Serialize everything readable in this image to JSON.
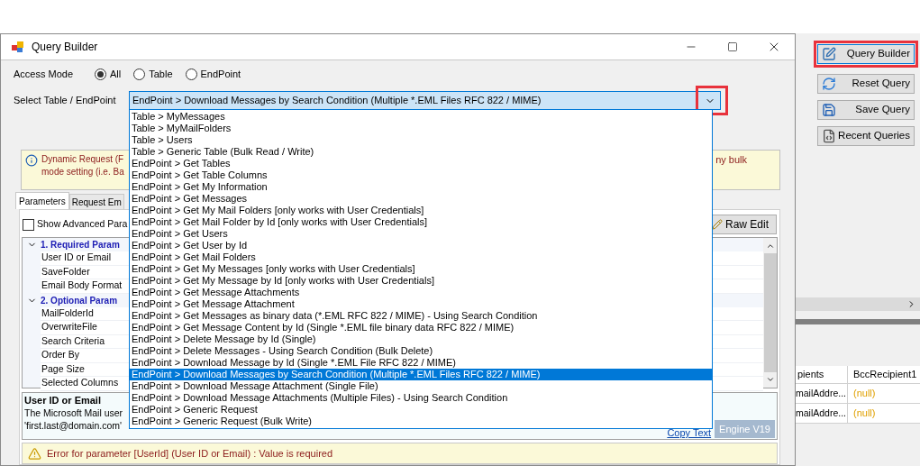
{
  "window": {
    "title": "Query Builder"
  },
  "access_mode": {
    "label": "Access Mode",
    "options": [
      {
        "label": "All",
        "selected": true
      },
      {
        "label": "Table",
        "selected": false
      },
      {
        "label": "EndPoint",
        "selected": false
      }
    ]
  },
  "select": {
    "label": "Select Table / EndPoint",
    "value": "EndPoint > Download Messages by Search Condition (Multiple *.EML Files RFC 822 / MIME)",
    "arrow_highlighted": true,
    "options": [
      {
        "label": "Table > MyMessages",
        "selected": false
      },
      {
        "label": "Table > MyMailFolders",
        "selected": false
      },
      {
        "label": "Table > Users",
        "selected": false
      },
      {
        "label": "Table > Generic Table (Bulk Read / Write)",
        "selected": false
      },
      {
        "label": "EndPoint > Get Tables",
        "selected": false
      },
      {
        "label": "EndPoint > Get Table Columns",
        "selected": false
      },
      {
        "label": "EndPoint > Get My Information",
        "selected": false
      },
      {
        "label": "EndPoint > Get Messages",
        "selected": false
      },
      {
        "label": "EndPoint > Get My Mail Folders [only works with User Credentials]",
        "selected": false
      },
      {
        "label": "EndPoint > Get Mail Folder by Id [only works with User Credentials]",
        "selected": false
      },
      {
        "label": "EndPoint > Get Users",
        "selected": false
      },
      {
        "label": "EndPoint > Get User by Id",
        "selected": false
      },
      {
        "label": "EndPoint > Get Mail Folders",
        "selected": false
      },
      {
        "label": "EndPoint > Get My Messages [only works with User Credentials]",
        "selected": false
      },
      {
        "label": "EndPoint > Get My Message by Id [only works with User Credentials]",
        "selected": false
      },
      {
        "label": "EndPoint > Get Message Attachments",
        "selected": false
      },
      {
        "label": "EndPoint > Get Message Attachment",
        "selected": false
      },
      {
        "label": "EndPoint > Get Messages as binary data (*.EML RFC 822 / MIME) - Using Search Condition",
        "selected": false
      },
      {
        "label": "EndPoint > Get Message Content by Id (Single *.EML file binary data RFC 822 / MIME)",
        "selected": false
      },
      {
        "label": "EndPoint > Delete Message by Id (Single)",
        "selected": false
      },
      {
        "label": "EndPoint > Delete Messages - Using Search Condition (Bulk Delete)",
        "selected": false
      },
      {
        "label": "EndPoint > Download Message by Id (Single *.EML File RFC 822 / MIME)",
        "selected": false
      },
      {
        "label": "EndPoint > Download Messages by Search Condition (Multiple *.EML Files RFC 822 / MIME)",
        "selected": true
      },
      {
        "label": "EndPoint > Download Message Attachment (Single File)",
        "selected": false
      },
      {
        "label": "EndPoint > Download Message Attachments (Multiple Files) - Using Search Condition",
        "selected": false
      },
      {
        "label": "EndPoint > Generic Request",
        "selected": false
      },
      {
        "label": "EndPoint > Generic Request (Bulk Write)",
        "selected": false
      }
    ]
  },
  "info_bar": {
    "line_1": "Dynamic Request (F",
    "line_1_end": "ny bulk",
    "line_2": "mode setting (i.e. Ba"
  },
  "tabs": [
    {
      "label": "Parameters",
      "selected": true
    },
    {
      "label": "Request Em",
      "selected": false
    }
  ],
  "show_advanced": {
    "label": "Show Advanced Para",
    "checked": false
  },
  "raw_edit": "Raw Edit",
  "property_grid": {
    "groups": [
      {
        "title": "1. Required Param",
        "expanded": true,
        "children": [
          {
            "name": "User ID or Email"
          },
          {
            "name": "SaveFolder"
          },
          {
            "name": "Email Body Format"
          }
        ]
      },
      {
        "title": "2. Optional Param",
        "expanded": true,
        "children": [
          {
            "name": "MailFolderId"
          },
          {
            "name": "OverwriteFile"
          },
          {
            "name": "Search Criteria"
          },
          {
            "name": "Order By"
          },
          {
            "name": "Page Size"
          },
          {
            "name": "Selected Columns"
          }
        ]
      }
    ]
  },
  "description": {
    "title": "User ID or Email",
    "line_1": "The Microsoft Mail user",
    "line_2": "'first.last@domain.com'",
    "link": "Copy Text",
    "badge": "Engine V19"
  },
  "error_bar": {
    "text": "Error for parameter [UserId] (User ID or Email) : Value is required"
  },
  "toolbar": [
    {
      "label": "Query Builder",
      "kind": "edit",
      "highlighted": true
    },
    {
      "label": "Reset Query",
      "kind": "refresh",
      "highlighted": false
    },
    {
      "label": "Save Query",
      "kind": "save",
      "highlighted": false
    },
    {
      "label": "Recent Queries",
      "kind": "sql",
      "highlighted": false
    }
  ],
  "background_grid": {
    "columns": [
      "pients",
      "BccRecipient1"
    ],
    "rows": [
      [
        "mailAddre...",
        "(null)"
      ],
      [
        "mailAddre...",
        "(null)"
      ]
    ]
  }
}
